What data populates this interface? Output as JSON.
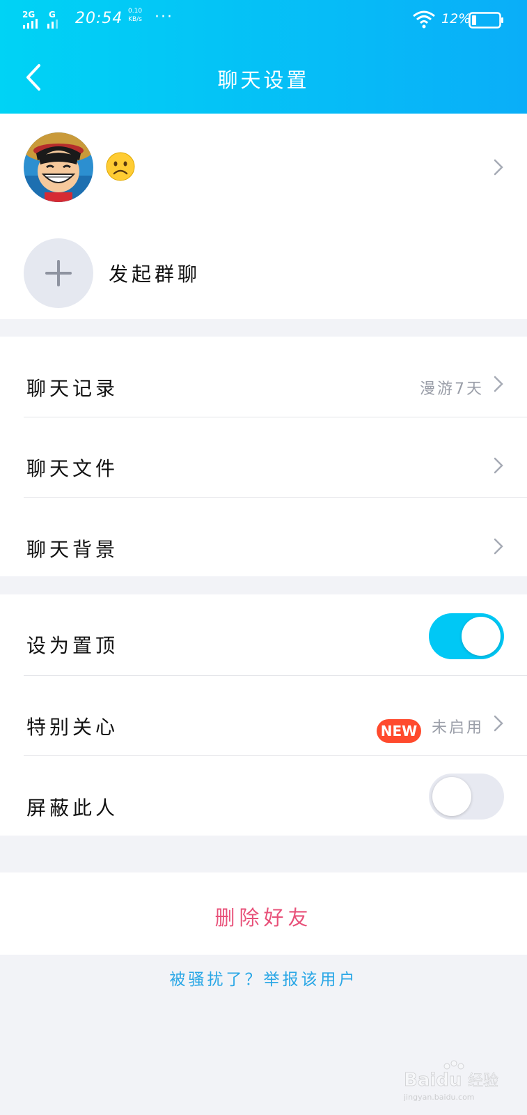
{
  "status_bar": {
    "network": "2G G",
    "time": "20:54",
    "speed_value": "0.10",
    "speed_unit": "KB/s",
    "more": "···",
    "battery": "12%"
  },
  "header": {
    "title": "聊天设置"
  },
  "contact": {
    "avatar": "avatar-image",
    "name_emoji": "frowning-face-emoji"
  },
  "group_chat": {
    "label": "发起群聊"
  },
  "records": [
    {
      "label": "聊天记录",
      "value": "漫游7天"
    },
    {
      "label": "聊天文件",
      "value": ""
    },
    {
      "label": "聊天背景",
      "value": ""
    }
  ],
  "settings": {
    "pin": {
      "label": "设为置顶",
      "enabled": true
    },
    "special": {
      "label": "特别关心",
      "badge": "NEW",
      "value": "未启用"
    },
    "block": {
      "label": "屏蔽此人",
      "enabled": false
    }
  },
  "delete": {
    "label": "删除好友"
  },
  "report": {
    "label": "被骚扰了？举报该用户"
  },
  "colors": {
    "header_start": "#00d3f5",
    "header_end": "#0aaef8",
    "toggle_on": "#00c8f5",
    "badge": "#ff4a2d",
    "delete": "#e8527a",
    "report": "#2aa7e6"
  }
}
